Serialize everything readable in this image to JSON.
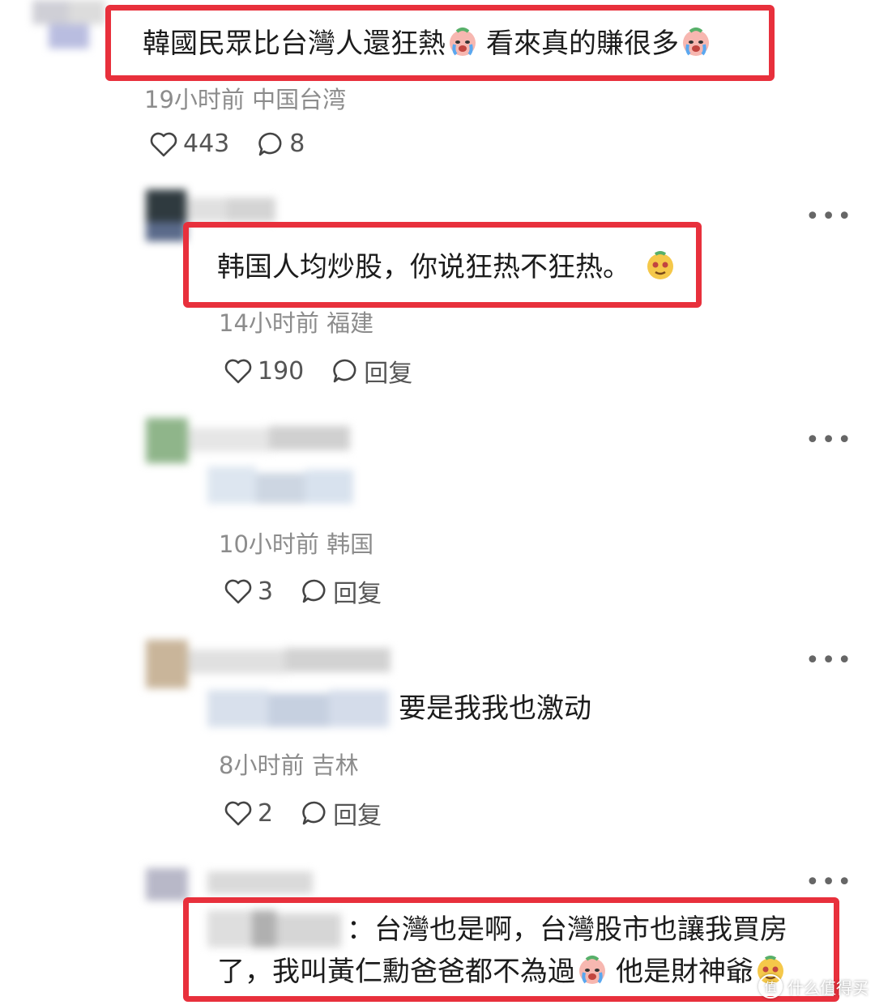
{
  "comments": [
    {
      "text_part1": "韓國民眾比台灣人還狂熱",
      "text_part2": "看來真的賺很多",
      "emoji": "crying-face",
      "time": "19小时前",
      "location": "中国台湾",
      "likes": "443",
      "replies": "8"
    },
    {
      "text": "韩国人均炒股，你说狂热不狂热。",
      "emoji": "smug-face",
      "time": "14小时前",
      "location": "福建",
      "likes": "190",
      "reply_label": "回复"
    },
    {
      "time": "10小时前",
      "location": "韩国",
      "likes": "3",
      "reply_label": "回复"
    },
    {
      "text": "要是我我也激动",
      "time": "8小时前",
      "location": "吉林",
      "likes": "2",
      "reply_label": "回复"
    },
    {
      "text_line1": "：台灣也是啊，台灣股市也讓我買房",
      "text_line2_part1": "了，我叫黃仁勳爸爸都不為過",
      "text_line2_part2": "他是財神爺",
      "emoji1": "crying-face",
      "emoji2": "smug-face"
    }
  ],
  "more_label": "•••",
  "watermark": "什么值得买",
  "icons": {
    "like": "heart-outline-icon",
    "reply": "speech-bubble-icon",
    "more": "more-dots-icon"
  },
  "colors": {
    "highlight": "#e8303c",
    "meta": "#8c8c8c"
  }
}
